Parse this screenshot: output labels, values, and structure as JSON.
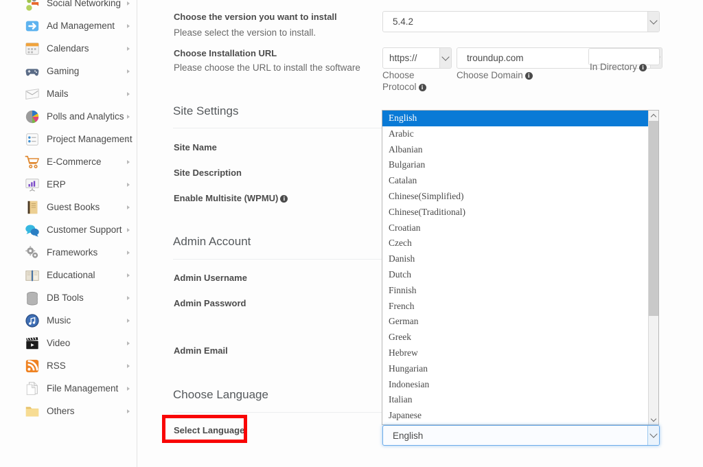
{
  "sidebar": {
    "items": [
      {
        "label": "Social Networking",
        "icon": "social-networking-icon"
      },
      {
        "label": "Ad Management",
        "icon": "ad-management-icon"
      },
      {
        "label": "Calendars",
        "icon": "calendar-icon"
      },
      {
        "label": "Gaming",
        "icon": "gamepad-icon"
      },
      {
        "label": "Mails",
        "icon": "mail-icon"
      },
      {
        "label": "Polls and Analytics",
        "icon": "pie-chart-icon"
      },
      {
        "label": "Project Management",
        "icon": "checklist-icon"
      },
      {
        "label": "E-Commerce",
        "icon": "shopping-cart-icon"
      },
      {
        "label": "ERP",
        "icon": "bar-chart-icon"
      },
      {
        "label": "Guest Books",
        "icon": "book-icon"
      },
      {
        "label": "Customer Support",
        "icon": "speech-bubbles-icon"
      },
      {
        "label": "Frameworks",
        "icon": "gears-icon"
      },
      {
        "label": "Educational",
        "icon": "open-book-icon"
      },
      {
        "label": "DB Tools",
        "icon": "database-icon"
      },
      {
        "label": "Music",
        "icon": "music-note-icon"
      },
      {
        "label": "Video",
        "icon": "clapperboard-icon"
      },
      {
        "label": "RSS",
        "icon": "rss-icon"
      },
      {
        "label": "File Management",
        "icon": "documents-icon"
      },
      {
        "label": "Others",
        "icon": "folder-icon"
      }
    ]
  },
  "form": {
    "version": {
      "label": "Choose the version you want to install",
      "hint": "Please select the version to install.",
      "value": "5.4.2"
    },
    "url": {
      "label": "Choose Installation URL",
      "hint": "Please choose the URL to install the software",
      "protocol_value": "https://",
      "protocol_caption": "Choose Protocol",
      "domain_value": "troundup.com",
      "domain_caption": "Choose Domain",
      "directory_value": "",
      "directory_caption": "In Directory"
    },
    "site_settings": {
      "heading": "Site Settings",
      "site_name_label": "Site Name",
      "site_description_label": "Site Description",
      "multisite_label": "Enable Multisite (WPMU)"
    },
    "admin_account": {
      "heading": "Admin Account",
      "username_label": "Admin Username",
      "password_label": "Admin Password",
      "email_label": "Admin Email"
    },
    "choose_language": {
      "heading": "Choose Language",
      "select_label": "Select Language",
      "selected_value": "English",
      "highlighted_option": "English",
      "options": [
        "English",
        "Arabic",
        "Albanian",
        "Bulgarian",
        "Catalan",
        "Chinese(Simplified)",
        "Chinese(Traditional)",
        "Croatian",
        "Czech",
        "Danish",
        "Dutch",
        "Finnish",
        "French",
        "German",
        "Greek",
        "Hebrew",
        "Hungarian",
        "Indonesian",
        "Italian",
        "Japanese"
      ]
    }
  },
  "annotation": {
    "highlight_color": "#f90505",
    "highlight_target": "Select Language"
  },
  "colors": {
    "dropdown_selected_bg": "#0a7ad6",
    "focus_border": "#6cacea",
    "text": "#4a4a4a"
  }
}
